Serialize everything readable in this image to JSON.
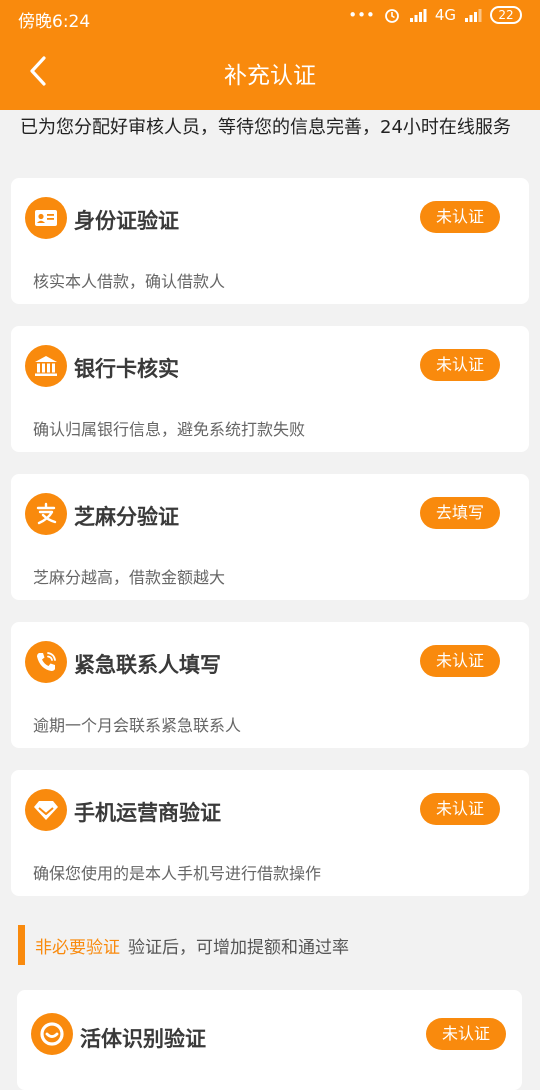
{
  "status_bar": {
    "time": "傍晚6:24",
    "network": "4G",
    "battery": "22"
  },
  "header": {
    "title": "补充认证"
  },
  "notice": "已为您分配好审核人员，等待您的信息完善，24小时在线服务",
  "cards": [
    {
      "title": "身份证验证",
      "desc": "核实本人借款，确认借款人",
      "button": "未认证",
      "icon": "id-card-icon"
    },
    {
      "title": "银行卡核实",
      "desc": "确认归属银行信息，避免系统打款失败",
      "button": "未认证",
      "icon": "bank-icon"
    },
    {
      "title": "芝麻分验证",
      "desc": "芝麻分越高，借款金额越大",
      "button": "去填写",
      "icon": "alipay-icon"
    },
    {
      "title": "紧急联系人填写",
      "desc": "逾期一个月会联系紧急联系人",
      "button": "未认证",
      "icon": "phone-icon"
    },
    {
      "title": "手机运营商验证",
      "desc": "确保您使用的是本人手机号进行借款操作",
      "button": "未认证",
      "icon": "diamond-icon"
    }
  ],
  "optional_section": {
    "label": "非必要验证",
    "subtitle": "验证后，可增加提额和通过率"
  },
  "optional_cards": [
    {
      "title": "活体识别验证",
      "button": "未认证",
      "icon": "face-recognition-icon"
    }
  ],
  "colors": {
    "accent": "#f98a0d",
    "background": "#f2f2f2"
  }
}
